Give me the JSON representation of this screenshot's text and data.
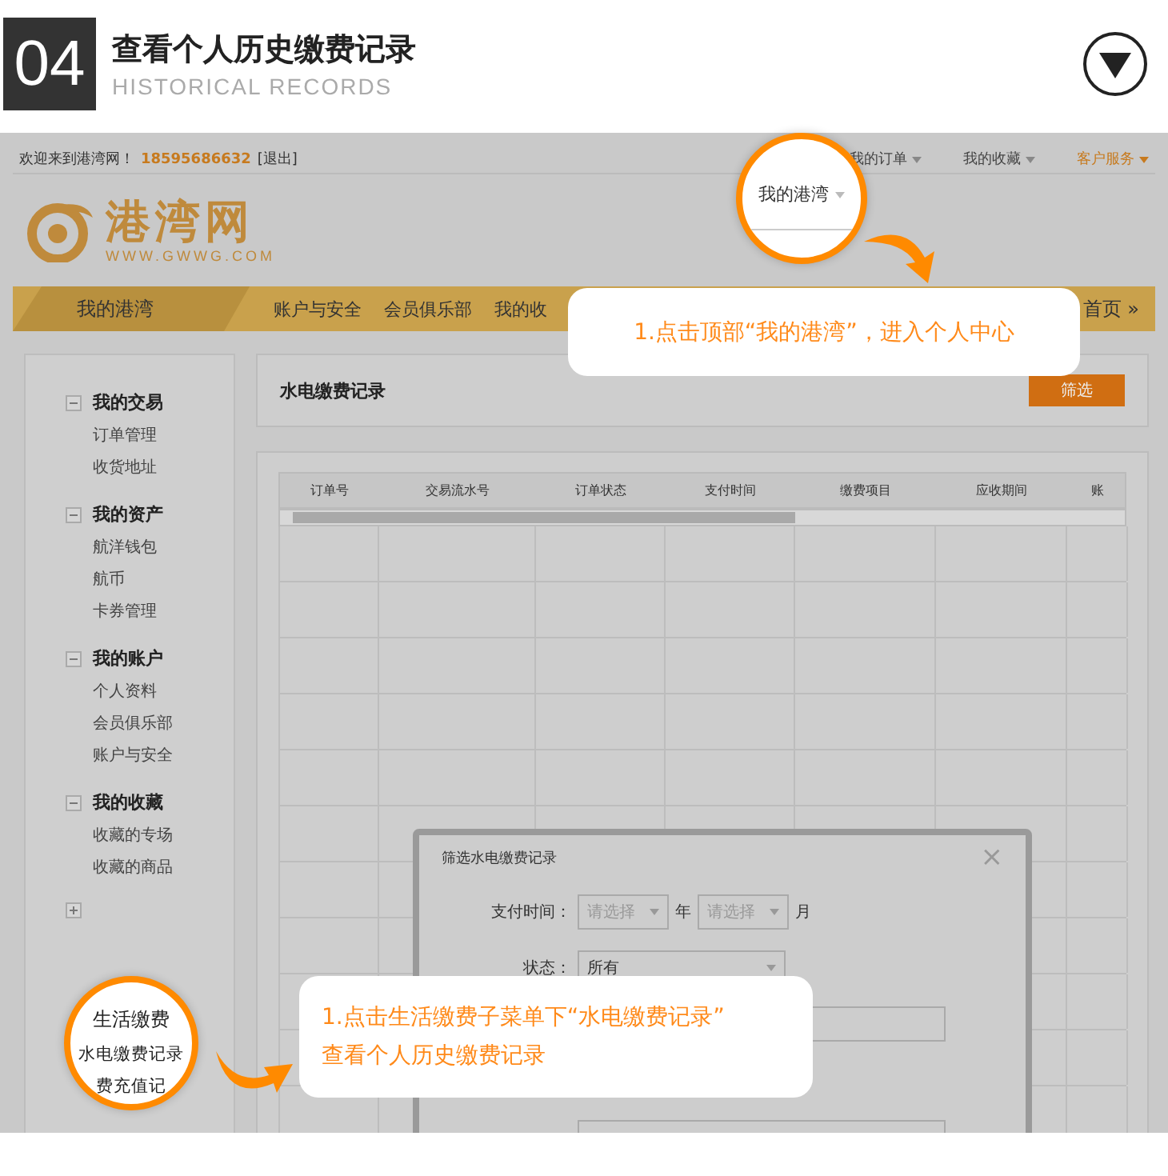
{
  "header": {
    "number": "04",
    "title": "查看个人历史缴费记录",
    "subtitle": "HISTORICAL RECORDS"
  },
  "topbar": {
    "welcome": "欢迎来到港湾网！",
    "phone": "18595686632",
    "logout": "[退出]",
    "links": [
      {
        "label": "我的订单",
        "highlight": false
      },
      {
        "label": "我的收藏",
        "highlight": false
      },
      {
        "label": "客户服务",
        "highlight": true
      }
    ]
  },
  "logo": {
    "name": "港湾网",
    "url": "WWW.GWWG.COM"
  },
  "nav": {
    "items": [
      {
        "label": "我的港湾",
        "selected": true
      },
      {
        "label": "账户与安全",
        "selected": false
      },
      {
        "label": "会员俱乐部",
        "selected": false
      },
      {
        "label": "我的收",
        "selected": false
      }
    ],
    "home": "首页",
    "home_icon": "»"
  },
  "sidebar": {
    "groups": [
      {
        "title": "我的交易",
        "expanded": true,
        "items": [
          "订单管理",
          "收货地址"
        ]
      },
      {
        "title": "我的资产",
        "expanded": true,
        "items": [
          "航洋钱包",
          "航币",
          "卡券管理"
        ]
      },
      {
        "title": "我的账户",
        "expanded": true,
        "items": [
          "个人资料",
          "会员俱乐部",
          "账户与安全"
        ]
      },
      {
        "title": "我的收藏",
        "expanded": true,
        "items": [
          "收藏的专场",
          "收藏的商品"
        ]
      },
      {
        "expanded": false
      }
    ]
  },
  "content": {
    "title": "水电缴费记录",
    "filter_button": "筛选"
  },
  "table": {
    "columns": [
      "订单号",
      "交易流水号",
      "订单状态",
      "支付时间",
      "缴费项目",
      "应收期间",
      "账"
    ]
  },
  "dialog": {
    "title": "筛选水电缴费记录",
    "close": "×",
    "rows": [
      {
        "kind": "date",
        "label": "支付时间：",
        "selects": [
          "请选择",
          "请选择"
        ],
        "units": [
          "年",
          "月"
        ]
      },
      {
        "kind": "select",
        "label": "状态：",
        "value": "所有"
      },
      {
        "kind": "input"
      },
      {
        "kind": "input"
      }
    ]
  },
  "magnifier_top": {
    "label": "我的港湾"
  },
  "magnifier_side": {
    "title": "生活缴费",
    "items": [
      "水电缴费记录",
      "费充值记"
    ]
  },
  "callouts": [
    {
      "lines": [
        "1.点击顶部“我的港湾”，进入个人中心"
      ]
    },
    {
      "lines": [
        "1.点击生活缴费子菜单下“水电缴费记录”",
        "查看个人历史缴费记录"
      ]
    }
  ]
}
